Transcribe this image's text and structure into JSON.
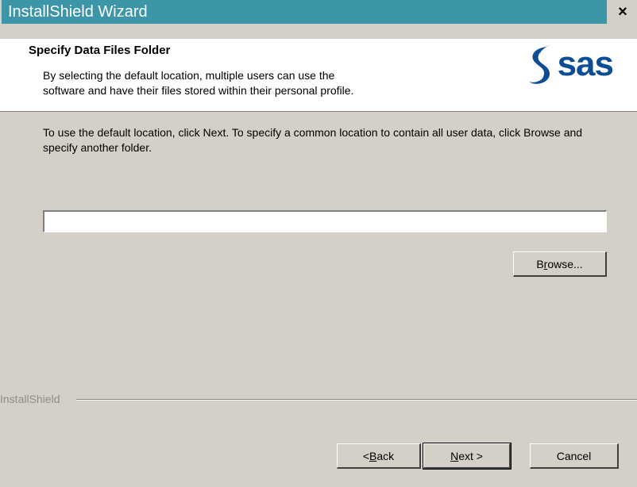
{
  "window": {
    "title": "InstallShield Wizard",
    "close_glyph": "×"
  },
  "header": {
    "heading": "Specify Data Files Folder",
    "description": "By selecting the default location, multiple users can use the\nsoftware and have their files stored within their personal profile.",
    "logo_text": "sas",
    "logo_icon": "sas-swirl-icon"
  },
  "body": {
    "instructions": "To use the default location, click Next.  To specify a common location to contain all user data, click Browse and specify another folder.",
    "path_value": "",
    "browse_label_pre": "B",
    "browse_label_acc": "r",
    "browse_label_post": "owse..."
  },
  "footer": {
    "brand": "InstallShield",
    "back_pre": "< ",
    "back_acc": "B",
    "back_post": "ack",
    "next_acc": "N",
    "next_post": "ext >",
    "cancel_label": "Cancel"
  },
  "colors": {
    "titlebar": "#3d96a8",
    "logo": "#0d4d94",
    "face": "#d4d0c8"
  }
}
